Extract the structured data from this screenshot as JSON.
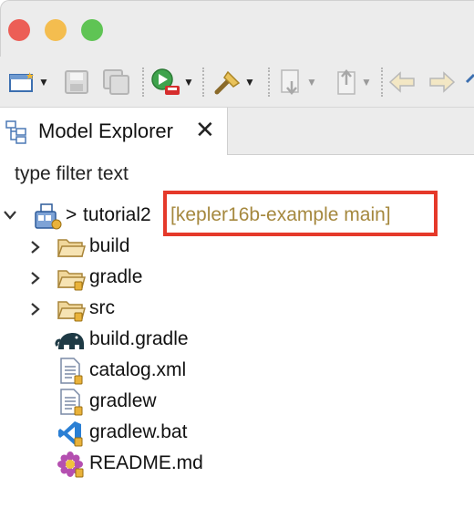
{
  "window": {
    "buttons": [
      "close",
      "minimize",
      "zoom"
    ],
    "colors": {
      "close": "#ec5e56",
      "minimize": "#f4bd4f",
      "zoom": "#5fc454"
    }
  },
  "toolbar": {
    "icons": [
      "new-wizard-icon",
      "save-icon",
      "save-all-icon",
      "run-icon",
      "tools-icon",
      "next-annotation-icon",
      "previous-annotation-icon",
      "back-icon",
      "forward-icon"
    ]
  },
  "view": {
    "tab_label": "Model Explorer",
    "close_glyph": "✕"
  },
  "filter": {
    "placeholder": "type filter text"
  },
  "tree": {
    "project": {
      "arrow": ">",
      "name": "tutorial2",
      "git": "[kepler16b-example main]"
    },
    "items": [
      {
        "label": "build",
        "icon": "folder-icon",
        "expandable": true
      },
      {
        "label": "gradle",
        "icon": "folder-icon",
        "expandable": true
      },
      {
        "label": "src",
        "icon": "folder-icon",
        "expandable": true
      },
      {
        "label": "build.gradle",
        "icon": "gradle-elephant-icon",
        "expandable": false
      },
      {
        "label": "catalog.xml",
        "icon": "text-file-icon",
        "expandable": false
      },
      {
        "label": "gradlew",
        "icon": "text-file-icon",
        "expandable": false
      },
      {
        "label": "gradlew.bat",
        "icon": "vscode-file-icon",
        "expandable": false
      },
      {
        "label": "README.md",
        "icon": "markdown-flower-icon",
        "expandable": false
      }
    ]
  },
  "highlight_color": "#e5392a"
}
